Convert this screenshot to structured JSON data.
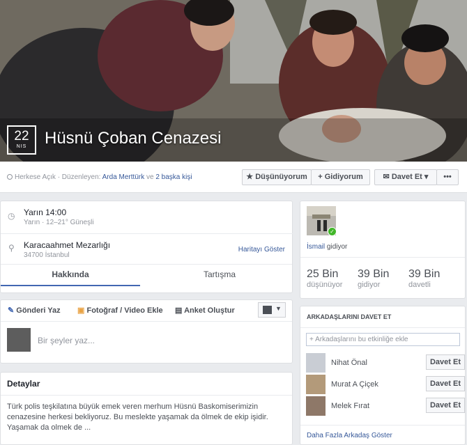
{
  "event": {
    "day": "22",
    "month": "NIS",
    "title": "Hüsnü Çoban Cenazesi",
    "privacy": "Herkese Açık",
    "organizer_prefix": "· Düzenleyen:",
    "organizer": "Arda Merttürk",
    "organizer_and": "ve",
    "others": "2 başka kişi"
  },
  "actions": {
    "interested": "Düşünüyorum",
    "going": "Gidiyorum",
    "invite": "Davet Et",
    "more": "•••"
  },
  "details": {
    "time": "Yarın 14:00",
    "time_sub": "Yarın · 12–21° Güneşli",
    "place": "Karacaahmet Mezarlığı",
    "place_sub": "34700 İstanbul",
    "map_link": "Haritayı Göster"
  },
  "tabs": {
    "about": "Hakkında",
    "discussion": "Tartışma"
  },
  "composer": {
    "post": "Gönderi Yaz",
    "photo": "Fotoğraf / Video Ekle",
    "poll": "Anket Oluştur",
    "placeholder": "Bir şeyler yaz..."
  },
  "detail_box": {
    "heading": "Detaylar",
    "text": "Türk polis teşkilatına büyük emek veren merhum Hüsnü Baskomiserimizin cenazesine herkesi bekliyoruz. Bu meslekte yaşamak da ölmek de ekip işidir. Yaşamak da olmek de ..."
  },
  "attending": {
    "person": "İsmail",
    "status": "gidiyor"
  },
  "stats": [
    {
      "value": "25 Bin",
      "label": "düşünüyor"
    },
    {
      "value": "39 Bin",
      "label": "gidiyor"
    },
    {
      "value": "39 Bin",
      "label": "davetli"
    }
  ],
  "invite_friends": {
    "heading": "ARKADAŞLARINI DAVET ET",
    "placeholder": "+ Arkadaşlarını bu etkinliğe ekle",
    "friends": [
      {
        "name": "Nihat Önal",
        "button": "Davet Et"
      },
      {
        "name": "Murat A Çiçek",
        "button": "Davet Et"
      },
      {
        "name": "Melek Fırat",
        "button": "Davet Et"
      }
    ],
    "more_link": "Daha Fazla Arkadaş Göster"
  }
}
